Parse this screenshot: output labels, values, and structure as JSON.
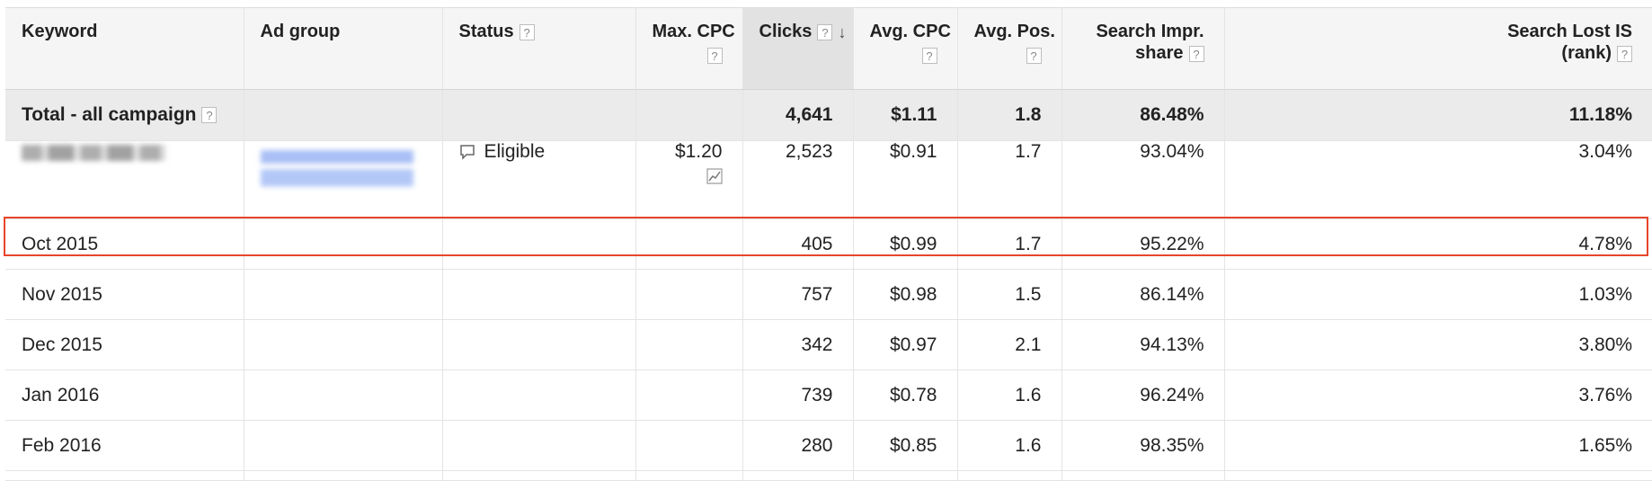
{
  "columns": [
    {
      "label": "Keyword",
      "help": false
    },
    {
      "label": "Ad group",
      "help": false
    },
    {
      "label": "Status",
      "help": true
    },
    {
      "label": "Max. CPC",
      "help": true
    },
    {
      "label": "Clicks",
      "help": true,
      "sorted": true
    },
    {
      "label": "Avg. CPC",
      "help": true
    },
    {
      "label": "Avg. Pos.",
      "help": true
    },
    {
      "label": "Search Impr.",
      "label2": "share",
      "help": true
    },
    {
      "label": "Search Lost IS",
      "label2": "(rank)",
      "help": true
    }
  ],
  "help_glyph": "?",
  "sort_glyph": "↓",
  "total_row": {
    "label": "Total - all campaign",
    "clicks": "4,641",
    "avg_cpc": "$1.11",
    "avg_pos": "1.8",
    "impr_share": "86.48%",
    "lost_is": "11.18%"
  },
  "keyword_row": {
    "status": "Eligible",
    "max_cpc": "$1.20",
    "clicks": "2,523",
    "avg_cpc": "$0.91",
    "avg_pos": "1.7",
    "impr_share": "93.04%",
    "lost_is": "3.04%"
  },
  "month_rows": [
    {
      "period": "Oct 2015",
      "clicks": "405",
      "avg_cpc": "$0.99",
      "avg_pos": "1.7",
      "impr_share": "95.22%",
      "lost_is": "4.78%",
      "highlighted": false
    },
    {
      "period": "Nov 2015",
      "clicks": "757",
      "avg_cpc": "$0.98",
      "avg_pos": "1.5",
      "impr_share": "86.14%",
      "lost_is": "1.03%",
      "highlighted": true
    },
    {
      "period": "Dec 2015",
      "clicks": "342",
      "avg_cpc": "$0.97",
      "avg_pos": "2.1",
      "impr_share": "94.13%",
      "lost_is": "3.80%",
      "highlighted": false
    },
    {
      "period": "Jan 2016",
      "clicks": "739",
      "avg_cpc": "$0.78",
      "avg_pos": "1.6",
      "impr_share": "96.24%",
      "lost_is": "3.76%",
      "highlighted": false
    },
    {
      "period": "Feb 2016",
      "clicks": "280",
      "avg_cpc": "$0.85",
      "avg_pos": "1.6",
      "impr_share": "98.35%",
      "lost_is": "1.65%",
      "highlighted": false
    }
  ],
  "icons": {
    "help": "help-icon",
    "sort": "sort-descending-icon",
    "status": "speech-bubble-icon",
    "bid_sim": "trend-chart-icon"
  },
  "colors": {
    "highlight_border": "#e8452b",
    "header_bg": "#f5f5f5",
    "sorted_header_bg": "#e2e2e2",
    "total_row_bg": "#ebebeb"
  }
}
